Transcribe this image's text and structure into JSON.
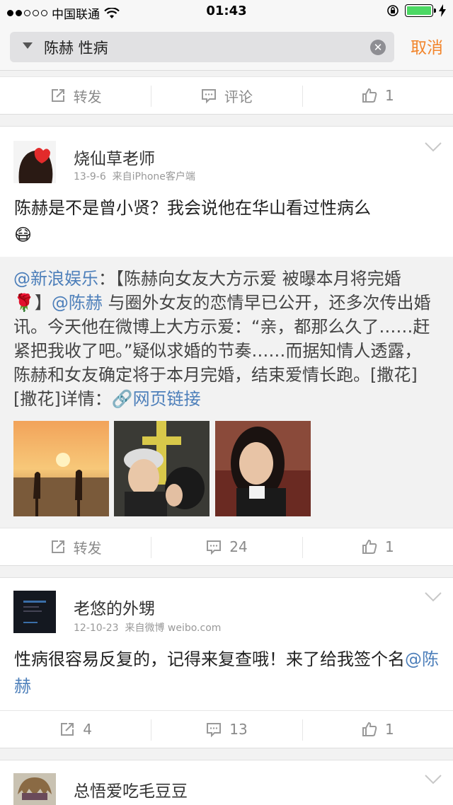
{
  "status_bar": {
    "carrier": "中国联通",
    "time": "01:43"
  },
  "search": {
    "query": "陈赫 性病",
    "cancel_label": "取消"
  },
  "top_actions": {
    "repost_label": "转发",
    "comment_label": "评论",
    "like_count": "1"
  },
  "posts": [
    {
      "user": "烧仙草老师",
      "date": "13-9-6",
      "source": "来自iPhone客户端",
      "text": "陈赫是不是曾小贤？我会说他在华山看过性病么",
      "emoji": "😷",
      "repost": {
        "mention": "@新浪娱乐",
        "colon": "：",
        "text1": "【陈赫向女友大方示爱 被曝本月将完婚",
        "rose": "🌹",
        "text2": "】",
        "mention2": "@陈赫",
        "text3": " 与圈外女友的恋情早已公开，还多次传出婚讯。今天他在微博上大方示爱：“亲，都那么久了……赶紧把我收了吧。”疑似求婚的节奏……而据知情人透露，陈赫和女友确定将于本月完婚，结束爱情长跑。[撒花][撒花]详情：",
        "link_label": "网页链接"
      },
      "actions": {
        "repost_label": "转发",
        "comment_count": "24",
        "like_count": "1"
      }
    },
    {
      "user": "老悠的外甥",
      "date": "12-10-23",
      "source": "来自微博 weibo.com",
      "text": "性病很容易反复的，记得来复查哦！来了给我签个名",
      "mention": "@陈赫",
      "actions": {
        "repost_count": "4",
        "comment_count": "13",
        "like_count": "1"
      }
    },
    {
      "user": "总悟爱吃毛豆豆"
    }
  ],
  "colors": {
    "accent": "#f2852b",
    "link": "#4d7fba",
    "battery": "#4cd964"
  }
}
